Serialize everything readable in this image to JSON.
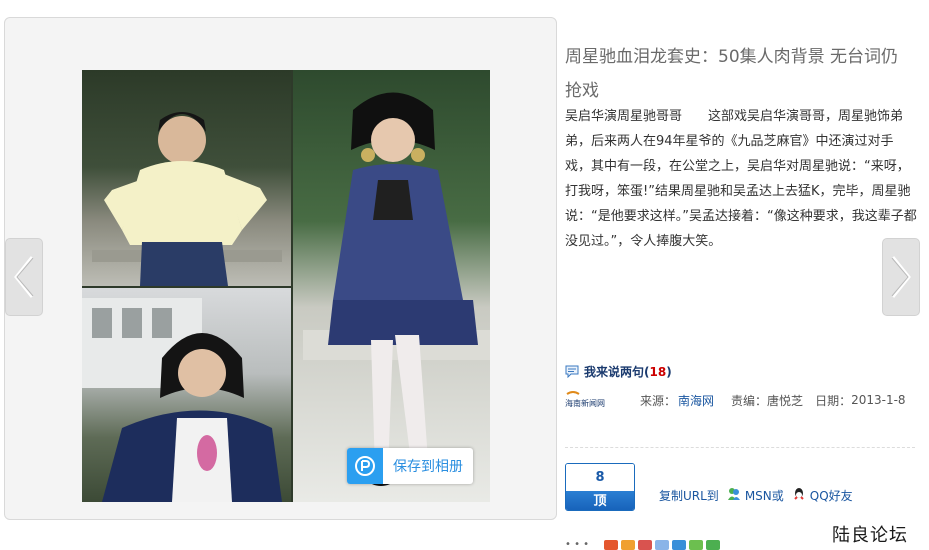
{
  "viewer": {
    "save_label": "保存到相册",
    "prev_icon": "chevron-left-icon",
    "next_icon": "chevron-right-icon"
  },
  "article": {
    "title": "周星驰血泪龙套史：50集人肉背景 无台词仍抢戏",
    "body": "吴启华演周星驰哥哥　　这部戏吴启华演哥哥，周星驰饰弟弟，后来两人在94年星爷的《九品芝麻官》中还演过对手戏，其中有一段，在公堂之上，吴启华对周星驰说：“来呀，打我呀，笨蛋!”结果周星驰和吴孟达上去猛K，完毕，周星驰说：“是他要求这样。”吴孟达接着：“像这种要求，我这辈子都没见过。”，令人捧腹大笑。"
  },
  "comment": {
    "label": "我来说两句",
    "count_open": "(",
    "count": "18",
    "count_close": ")"
  },
  "meta": {
    "logo_text": "海南新闻网",
    "source_label": "来源：",
    "source": "南海网",
    "editor_label": "责编：",
    "editor": "唐悦芝",
    "date_label": "日期：",
    "date": "2013-1-8"
  },
  "vote": {
    "count": "8",
    "label": "顶"
  },
  "share": {
    "copy_url": "复制URL到",
    "msn": "MSN或",
    "qq": "QQ好友"
  },
  "watermark": "陆良论坛",
  "colors": {
    "accent_blue": "#2b9ff0",
    "link_blue": "#1a56a0",
    "count_red": "#cc0000"
  }
}
